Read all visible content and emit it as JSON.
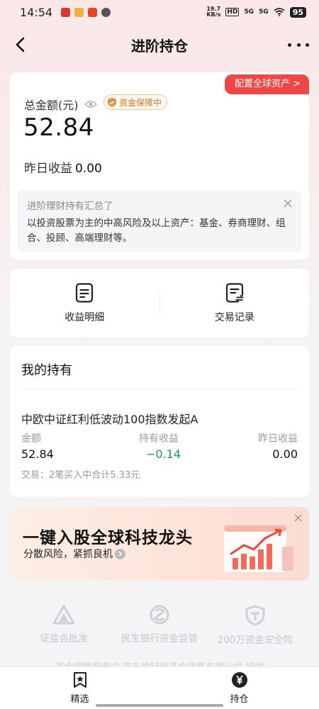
{
  "status": {
    "time": "14:54",
    "net_speed": "19.7 KB/s",
    "hd": "HD",
    "sig1": "5G",
    "sig2": "5G",
    "battery": "95"
  },
  "nav": {
    "title": "进阶持仓"
  },
  "summary": {
    "global_tag": "配置全球资产 >",
    "total_label": "总金额(元)",
    "badge": "资金保障中",
    "total_value": "52.84",
    "yesterday_label": "昨日收益",
    "yesterday_value": "0.00",
    "notice_title": "进阶理财持有汇总了",
    "notice_text": "以投资股票为主的中高风险及以上资产：基金、券商理财、组合、投顾、高端理财等。"
  },
  "actions": [
    {
      "label": "收益明细",
      "icon": "document-icon"
    },
    {
      "label": "交易记录",
      "icon": "transaction-record-icon"
    }
  ],
  "holdings": {
    "title": "我的持有",
    "fund_name": "中欧中证红利低波动100指数发起A",
    "col_amount_label": "金额",
    "col_profit_label": "持有收益",
    "col_yesterday_label": "昨日收益",
    "amount": "52.84",
    "profit": "−0.14",
    "yesterday": "0.00",
    "trade_note": "交易：2笔买入中合计5.33元",
    "profit_color": "#1a9b55"
  },
  "banner": {
    "title": "一键入股全球科技龙头",
    "subtitle": "分散风险，紧抓良机"
  },
  "trust": [
    {
      "label": "证监会批准"
    },
    {
      "label": "民生银行资金监管"
    },
    {
      "label": "200万资金安全险"
    }
  ],
  "footer_note": "基金销售服务由 京东肯特瑞基金销售有限公司 提供",
  "tabs": [
    {
      "label": "精选",
      "icon": "bookmark-star-icon"
    },
    {
      "label": "持仓",
      "icon": "yen-circle-icon"
    }
  ],
  "colors": {
    "accent_red": "#ef4646",
    "gain_green": "#1a9b55"
  }
}
